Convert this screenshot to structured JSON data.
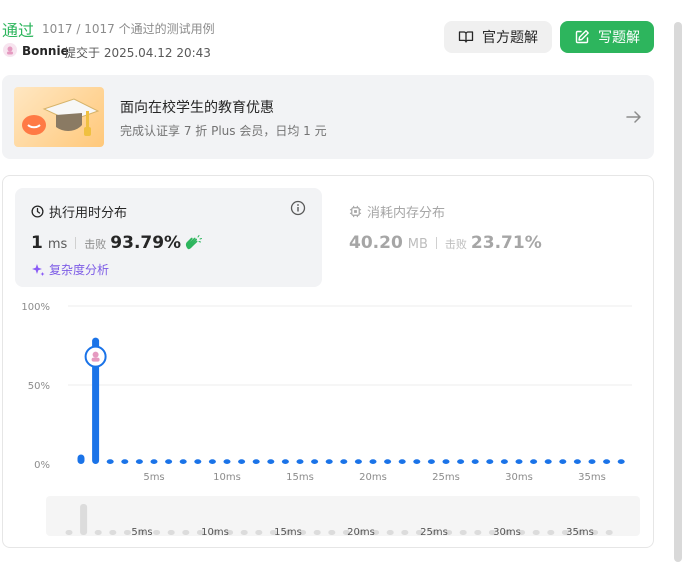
{
  "header": {
    "status": "通过",
    "passed_count": "1017 / 1017 个通过的测试用例",
    "user": "Bonnie",
    "submitted_at": "提交于 2025.04.12 20:43",
    "official_solution_label": "官方题解",
    "write_solution_label": "写题解"
  },
  "promo": {
    "title": "面向在校学生的教育优惠",
    "subtitle": "完成认证享 7 折 Plus 会员，日均 1 元"
  },
  "runtime": {
    "title": "执行用时分布",
    "value": "1",
    "unit": "ms",
    "beats_label": "击败",
    "beats_percent": "93.79%",
    "complexity_label": "复杂度分析"
  },
  "memory": {
    "title": "消耗内存分布",
    "value": "40.20",
    "unit": "MB",
    "beats_label": "击败",
    "beats_percent": "23.71%"
  },
  "colors": {
    "accent_green": "#2db55d",
    "bar_blue": "#1a73e8",
    "purple": "#7d5ce6"
  },
  "chart_data": {
    "type": "bar",
    "x": [
      0,
      1,
      2,
      3,
      4,
      5,
      6,
      7,
      8,
      9,
      10,
      11,
      12,
      13,
      14,
      15,
      16,
      17,
      18,
      19,
      20,
      21,
      22,
      23,
      24,
      25,
      26,
      27,
      28,
      29,
      30,
      31,
      32,
      33,
      34,
      35,
      36,
      37
    ],
    "values": [
      6,
      80,
      3,
      3,
      3,
      3,
      3,
      3,
      3,
      3,
      3,
      3,
      3,
      3,
      3,
      3,
      3,
      3,
      3,
      3,
      3,
      3,
      3,
      3,
      3,
      3,
      3,
      3,
      3,
      3,
      3,
      3,
      3,
      3,
      3,
      3,
      3,
      3
    ],
    "highlight_x": 1,
    "y_ticks": [
      "0%",
      "50%",
      "100%"
    ],
    "ylim": [
      0,
      100
    ],
    "x_tick_values": [
      5,
      10,
      15,
      20,
      25,
      30,
      35
    ],
    "x_tick_labels": [
      "5ms",
      "10ms",
      "15ms",
      "20ms",
      "25ms",
      "30ms",
      "35ms"
    ],
    "grid": true,
    "xlabel": "",
    "ylabel": ""
  }
}
